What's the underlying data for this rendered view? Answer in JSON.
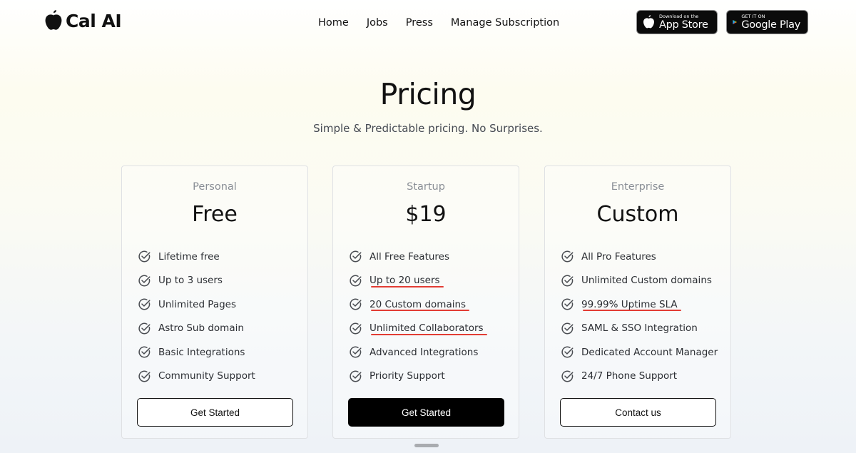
{
  "brand": {
    "name": "Cal AI",
    "logo_icon": "apple-icon"
  },
  "nav": {
    "items": [
      {
        "label": "Home"
      },
      {
        "label": "Jobs"
      },
      {
        "label": "Press"
      },
      {
        "label": "Manage Subscription"
      }
    ]
  },
  "stores": {
    "apple": {
      "small": "Download on the",
      "big": "App Store"
    },
    "google": {
      "small": "GET IT ON",
      "big": "Google Play"
    }
  },
  "hero": {
    "title": "Pricing",
    "subtitle": "Simple & Predictable pricing. No Surprises."
  },
  "plans": [
    {
      "tier": "Personal",
      "price": "Free",
      "features": [
        "Lifetime free",
        "Up to 3 users",
        "Unlimited Pages",
        "Astro Sub domain",
        "Basic Integrations",
        "Community Support"
      ],
      "cta": "Get Started",
      "cta_style": "outline"
    },
    {
      "tier": "Startup",
      "price": "$19",
      "features": [
        "All Free Features",
        "Up to 20 users",
        "20 Custom domains",
        "Unlimited Collaborators",
        "Advanced Integrations",
        "Priority Support"
      ],
      "highlighted_features": [
        "Up to 20 users",
        "20 Custom domains",
        "Unlimited Collaborators"
      ],
      "cta": "Get Started",
      "cta_style": "filled"
    },
    {
      "tier": "Enterprise",
      "price": "Custom",
      "features": [
        "All Pro Features",
        "Unlimited Custom domains",
        "99.99% Uptime SLA",
        "SAML & SSO Integration",
        "Dedicated Account Manager",
        "24/7 Phone Support"
      ],
      "highlighted_features": [
        "99.99% Uptime SLA"
      ],
      "cta": "Contact us",
      "cta_style": "outline"
    }
  ],
  "colors": {
    "highlight_underline": "#e23c34",
    "primary_button": "#000000"
  }
}
